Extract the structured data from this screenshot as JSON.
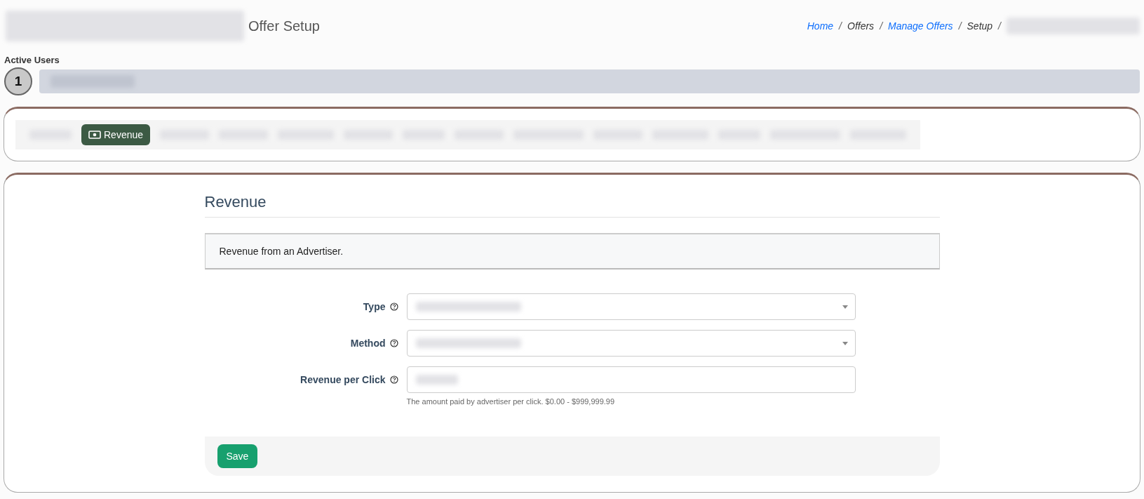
{
  "header": {
    "title": "Offer Setup",
    "breadcrumb": [
      {
        "label": "Home",
        "link": true,
        "separator": "/"
      },
      {
        "label": "Offers",
        "link": false,
        "separator": "/"
      },
      {
        "label": "Manage Offers",
        "link": true,
        "separator": "/"
      },
      {
        "label": "Setup",
        "link": false,
        "separator": "/"
      }
    ]
  },
  "active_users": {
    "label": "Active Users",
    "count": "1"
  },
  "tabs": [
    {
      "label": "Revenue",
      "selected": true
    }
  ],
  "section": {
    "title": "Revenue",
    "info": "Revenue from an Advertiser.",
    "fields": [
      {
        "label": "Type",
        "kind": "select"
      },
      {
        "label": "Method",
        "kind": "select"
      },
      {
        "label": "Revenue per Click",
        "kind": "text",
        "help": "The amount paid by advertiser per click. $0.00 - $999,999.99"
      }
    ],
    "save": "Save"
  }
}
